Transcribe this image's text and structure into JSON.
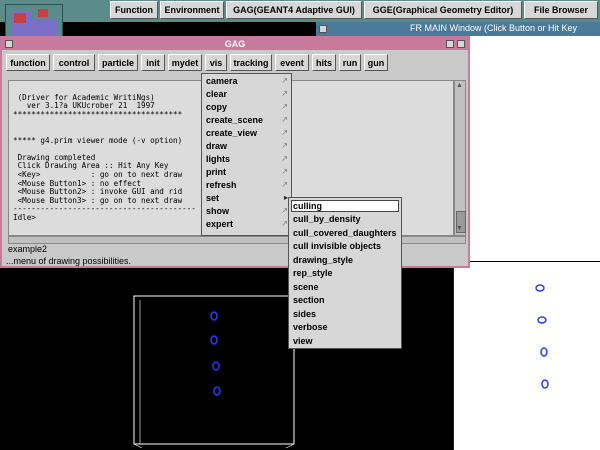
{
  "top_buttons": [
    {
      "label": "Function"
    },
    {
      "label": "Environment"
    },
    {
      "label": "GAG(GEANT4 Adaptive GUI)"
    },
    {
      "label": "GGE(Graphical Geometry Editor)"
    },
    {
      "label": "File Browser"
    }
  ],
  "fr_window": {
    "title": "FR MAIN Window (Click Button or Hit Key"
  },
  "gag_window": {
    "title": "GAG",
    "menubar": [
      "function",
      "control",
      "particle",
      "init",
      "mydet",
      "vis",
      "tracking",
      "event",
      "hits",
      "run",
      "gun"
    ],
    "console_lines": [
      "",
      " (Driver for Academic WritiNgs)",
      "   ver 3.1?a UKUcrober 21  1997",
      "*************************************",
      "",
      "",
      "***** g4.prim viewer mode (-v option)",
      "",
      " Drawing completed",
      " Click Drawing Area :: Hit Any Key",
      " <Key>           : go on to next draw",
      " <Mouse Button1> : no effect",
      " <Mouse Button2> : invoke GUI and rid",
      " <Mouse Button3> : go on to next draw",
      "----------------------------------------",
      "Idle>"
    ],
    "command_value": "example2",
    "status": "...menu of drawing possibilities."
  },
  "vis_menu": {
    "items": [
      "camera",
      "clear",
      "copy",
      "create_scene",
      "create_view",
      "draw",
      "lights",
      "print",
      "refresh",
      "set",
      "show",
      "expert"
    ]
  },
  "set_menu": {
    "items": [
      "culling",
      "cull_by_density",
      "cull_covered_daughters",
      "cull invisible objects",
      "drawing_style",
      "rep_style",
      "scene",
      "section",
      "sides",
      "verbose",
      "view"
    ],
    "selected": "culling"
  },
  "colors": {
    "gag_frame": "#c87a9c",
    "desktop": "#5a8c8c",
    "fr_bar": "#4a7a9a",
    "detector_blue": "#2a3aff"
  }
}
